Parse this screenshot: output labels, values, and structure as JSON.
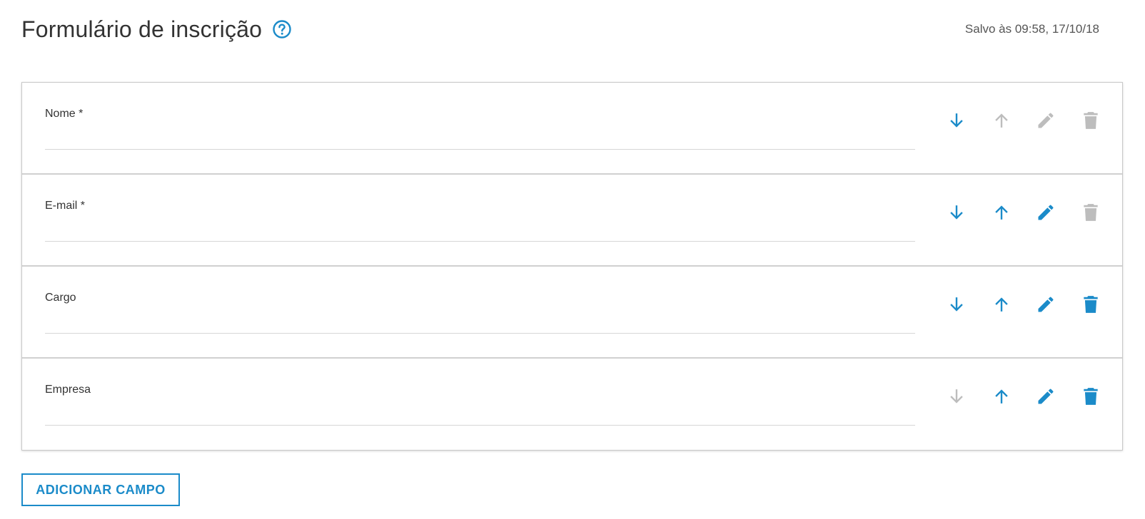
{
  "header": {
    "title": "Formulário de inscrição",
    "saved_status": "Salvo às 09:58, 17/10/18",
    "help_icon": "help-circle-icon"
  },
  "colors": {
    "accent": "#1b8bc9",
    "disabled": "#bdbdbd"
  },
  "fields": [
    {
      "label": "Nome *",
      "actions": {
        "move_down": true,
        "move_up": false,
        "edit": false,
        "delete": false
      }
    },
    {
      "label": "E-mail *",
      "actions": {
        "move_down": true,
        "move_up": true,
        "edit": true,
        "delete": false
      }
    },
    {
      "label": "Cargo",
      "actions": {
        "move_down": true,
        "move_up": true,
        "edit": true,
        "delete": true
      }
    },
    {
      "label": "Empresa",
      "actions": {
        "move_down": false,
        "move_up": true,
        "edit": true,
        "delete": true
      }
    }
  ],
  "icons": {
    "move_down": "arrow-down-icon",
    "move_up": "arrow-up-icon",
    "edit": "pencil-icon",
    "delete": "trash-icon"
  },
  "add_button_label": "ADICIONAR CAMPO"
}
